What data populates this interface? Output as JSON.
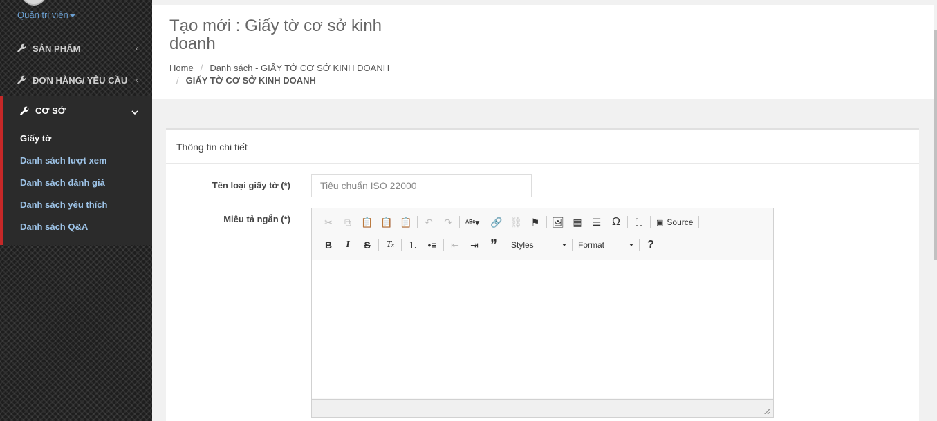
{
  "sidebar": {
    "user_role": "Quản trị viên",
    "menu": [
      {
        "label": "SẢN PHẨM"
      },
      {
        "label": "ĐƠN HÀNG/ YÊU CẦU"
      }
    ],
    "active_menu": {
      "label": "CƠ SỞ",
      "items": [
        {
          "label": "Giấy tờ"
        },
        {
          "label": "Danh sách lượt xem"
        },
        {
          "label": "Danh sách đánh giá"
        },
        {
          "label": "Danh sách yêu thích"
        },
        {
          "label": "Danh sách Q&A"
        }
      ]
    }
  },
  "header": {
    "title": "Tạo mới : Giấy tờ cơ sở kinh doanh",
    "breadcrumb": {
      "home": "Home",
      "list": "Danh sách - GIẤY TỜ CƠ SỞ KINH DOANH",
      "current": "GIẤY TỜ CƠ SỞ KINH DOANH"
    }
  },
  "form": {
    "card_title": "Thông tin chi tiết",
    "name_label": "Tên loại giấy tờ (*)",
    "name_placeholder": "Tiêu chuẩn ISO 22000",
    "desc_label": "Miêu tả ngắn (*)"
  },
  "editor": {
    "source_label": "Source",
    "styles_label": "Styles",
    "format_label": "Format",
    "icons_row1": [
      "cut-icon",
      "copy-icon",
      "paste-icon",
      "paste-text-icon",
      "paste-word-icon",
      "undo-icon",
      "redo-icon",
      "spellcheck-icon",
      "link-icon",
      "unlink-icon",
      "anchor-icon",
      "image-icon",
      "table-icon",
      "horizontal-line-icon",
      "special-char-icon",
      "maximize-icon",
      "source-icon"
    ],
    "icons_row2": [
      "bold-icon",
      "italic-icon",
      "strike-icon",
      "remove-format-icon",
      "numbered-list-icon",
      "bulleted-list-icon",
      "outdent-icon",
      "indent-icon",
      "blockquote-icon",
      "help-icon"
    ]
  },
  "colors": {
    "accent_red": "#c62828",
    "link_blue": "#9ec4e8"
  }
}
